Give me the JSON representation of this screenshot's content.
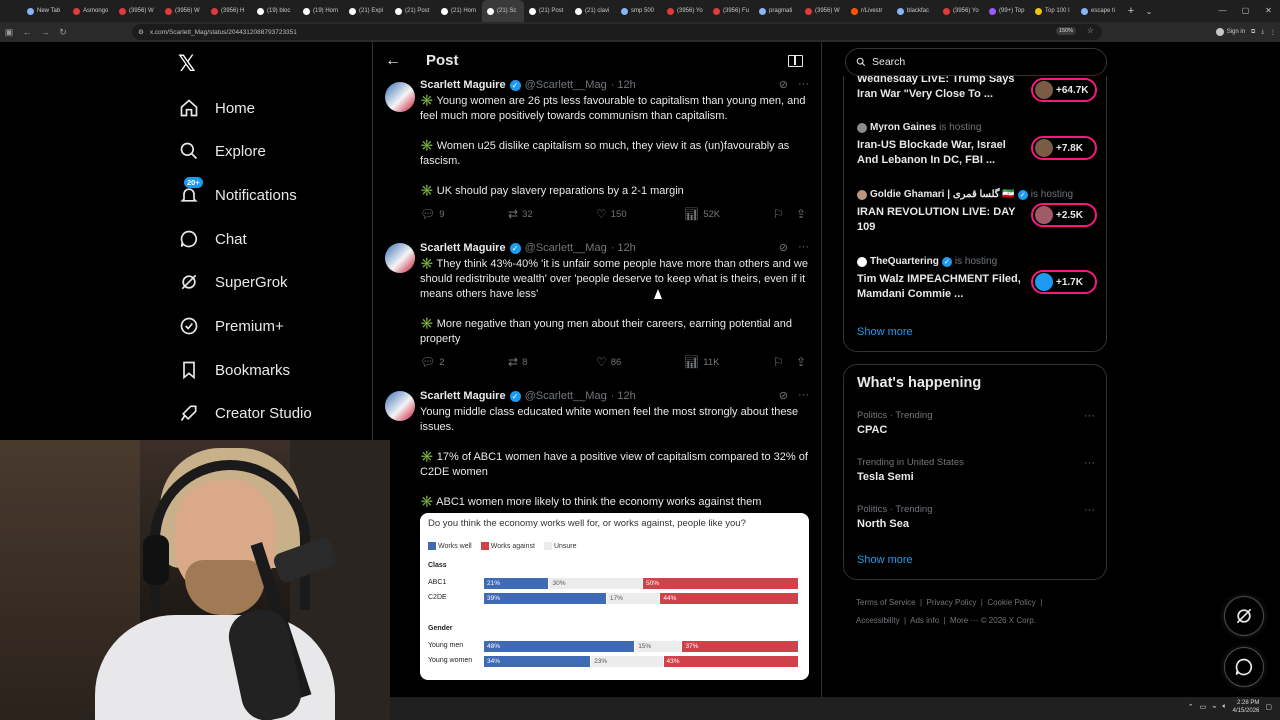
{
  "browser": {
    "tabs": [
      {
        "label": "New Tab",
        "color": "#8ab4f8"
      },
      {
        "label": "Asmongo",
        "color": "#e03a3a"
      },
      {
        "label": "(3956) W",
        "color": "#e03a3a"
      },
      {
        "label": "(3956) W",
        "color": "#e03a3a"
      },
      {
        "label": "(3956) H",
        "color": "#e03a3a"
      },
      {
        "label": "(19) bloc",
        "color": "#ffffff"
      },
      {
        "label": "(19) Hom",
        "color": "#ffffff"
      },
      {
        "label": "(21) Expl",
        "color": "#ffffff"
      },
      {
        "label": "(21) Post",
        "color": "#ffffff"
      },
      {
        "label": "(21) Hom",
        "color": "#ffffff"
      },
      {
        "label": "(21) Sc",
        "color": "#ffffff"
      },
      {
        "label": "(21) Post",
        "color": "#ffffff"
      },
      {
        "label": "(21) clavi",
        "color": "#ffffff"
      },
      {
        "label": "smp 500",
        "color": "#8ab4f8"
      },
      {
        "label": "(3956) Yo",
        "color": "#e03a3a"
      },
      {
        "label": "(3956) Fu",
        "color": "#e03a3a"
      },
      {
        "label": "pragmati",
        "color": "#8ab4f8"
      },
      {
        "label": "(3956) W",
        "color": "#e03a3a"
      },
      {
        "label": "r/Livestr",
        "color": "#ff5700"
      },
      {
        "label": "blackfac",
        "color": "#8ab4f8"
      },
      {
        "label": "(3956) Yo",
        "color": "#e03a3a"
      },
      {
        "label": "(99+) Top",
        "color": "#9b59ff"
      },
      {
        "label": "Top 100 I",
        "color": "#f1c40f"
      },
      {
        "label": "escape ti",
        "color": "#8ab4f8"
      }
    ],
    "active_tab_index": 10,
    "url": "x.com/Scarlett_Mag/status/2044312088793723351",
    "zoom": "150%",
    "signin_label": "Sign in"
  },
  "nav": {
    "logo": "𝕏",
    "items": [
      {
        "label": "Home",
        "icon": "home-icon"
      },
      {
        "label": "Explore",
        "icon": "search-icon"
      },
      {
        "label": "Notifications",
        "icon": "bell-icon",
        "badge": "20+"
      },
      {
        "label": "Chat",
        "icon": "chat-icon"
      },
      {
        "label": "SuperGrok",
        "icon": "grok-icon"
      },
      {
        "label": "Premium+",
        "icon": "premium-icon"
      },
      {
        "label": "Bookmarks",
        "icon": "bookmark-icon"
      },
      {
        "label": "Creator Studio",
        "icon": "rocket-icon"
      }
    ]
  },
  "main": {
    "header_title": "Post",
    "tweets": [
      {
        "name": "Scarlett Maguire",
        "handle": "@Scarlett__Mag",
        "time": "· 12h",
        "paragraphs": [
          "✳️ Young women are 26 pts less favourable to capitalism than young men, and feel much more positively towards communism than capitalism.",
          "✳️ Women u25 dislike capitalism so much, they view it as (un)favourably as fascism.",
          "✳️ UK should pay slavery reparations by a 2-1 margin"
        ],
        "replies": "9",
        "reposts": "32",
        "likes": "150",
        "views": "52K"
      },
      {
        "name": "Scarlett Maguire",
        "handle": "@Scarlett__Mag",
        "time": "· 12h",
        "paragraphs": [
          "✳️ They think 43%-40% 'it is unfair some people have more than others and we should redistribute wealth' over 'people deserve to keep what is theirs, even if it means others have less'",
          "✳️ More negative than young men about their careers, earning potential and property"
        ],
        "replies": "2",
        "reposts": "8",
        "likes": "86",
        "views": "11K"
      },
      {
        "name": "Scarlett Maguire",
        "handle": "@Scarlett__Mag",
        "time": "· 12h",
        "paragraphs": [
          "Young middle class educated white women feel the most strongly about these issues.",
          "✳️ 17% of ABC1 women have a positive view of capitalism compared to 32% of C2DE women",
          "✳️ ABC1 women more likely to think the economy works against them"
        ]
      }
    ]
  },
  "chart_data": {
    "type": "bar",
    "title": "Do you think the economy works well for, or works against, people like you?",
    "legend": [
      "Works well",
      "Works against",
      "Unsure"
    ],
    "colors": {
      "works_well": "#3e6bb4",
      "works_against": "#d0424a",
      "unsure": "#ececec"
    },
    "groups": [
      {
        "name": "Class",
        "rows": [
          {
            "category": "ABC1",
            "works_well": 21,
            "unsure": 30,
            "works_against": 50
          },
          {
            "category": "C2DE",
            "works_well": 39,
            "unsure": 17,
            "works_against": 44
          }
        ]
      },
      {
        "name": "Gender",
        "rows": [
          {
            "category": "Young men",
            "works_well": 48,
            "unsure": 15,
            "works_against": 37
          },
          {
            "category": "Young women",
            "works_well": 34,
            "unsure": 23,
            "works_against": 43
          }
        ]
      }
    ]
  },
  "sidebar": {
    "search_placeholder": "Search",
    "live": [
      {
        "host": "",
        "title": "Wednesday LIVE: Trump Says Iran War \"Very Close To ...",
        "count": "+64.7K",
        "host_suffix": ""
      },
      {
        "host": "Myron Gaines",
        "host_suffix": "is hosting",
        "title": "Iran-US Blockade War, Israel And Lebanon In DC, FBI ...",
        "count": "+7.8K"
      },
      {
        "host": "Goldie Ghamari | گلسا قمری 🇮🇷",
        "host_suffix": "is hosting",
        "title": "IRAN REVOLUTION LIVE: DAY 109",
        "count": "+2.5K"
      },
      {
        "host": "TheQuartering",
        "host_suffix": "is hosting",
        "title": "Tim Walz IMPEACHMENT Filed, Mamdani Commie ...",
        "count": "+1.7K"
      }
    ],
    "live_show_more": "Show more",
    "happening_title": "What's happening",
    "trends": [
      {
        "context": "Politics · Trending",
        "topic": "CPAC"
      },
      {
        "context": "Trending in United States",
        "topic": "Tesla Semi"
      },
      {
        "context": "Politics · Trending",
        "topic": "North Sea"
      }
    ],
    "trends_show_more": "Show more",
    "footer_links": [
      "Terms of Service",
      "Privacy Policy",
      "Cookie Policy",
      "Accessibility",
      "Ads info",
      "More ···",
      "© 2026 X Corp."
    ]
  },
  "taskbar": {
    "time": "2:28 PM",
    "date": "4/15/2026"
  }
}
